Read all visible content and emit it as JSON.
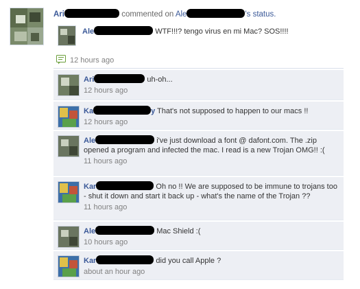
{
  "post": {
    "actor_prefix": "Ari",
    "verb": "commented on",
    "target_prefix": "Ale",
    "target_suffix": "'s status.",
    "status_author_prefix": "Ale",
    "status_text": "WTF!!!? tengo virus en mi Mac? SOS!!!!",
    "time": "12 hours ago",
    "comment_icon": "comment-bubble-icon"
  },
  "comments": [
    {
      "author_prefix": "Ari",
      "text": "uh-oh...",
      "time": "12 hours ago"
    },
    {
      "author_prefix": "Ka",
      "author_tail": "y",
      "text": "That's not supposed to happen to our macs !!",
      "time": "12 hours ago"
    },
    {
      "author_prefix": "Ale",
      "text": "i've just download a font @ dafont.com. The .zip opened a program and infected the mac. I read is a new Trojan OMG!! :(",
      "time": "11 hours ago"
    },
    {
      "author_prefix": "Kar",
      "text": "Oh no !! We are supposed to be immune to trojans too - shut it down and start it back up - what's the name of the Trojan ??",
      "time": "11 hours ago"
    },
    {
      "author_prefix": "Ale",
      "text": "Mac Shield :(",
      "time": "10 hours ago"
    },
    {
      "author_prefix": "Kar",
      "text": "did you call Apple ?",
      "time": "about an hour ago"
    }
  ],
  "colors": {
    "link": "#3b5998",
    "comment_bg": "#edeff4",
    "muted": "#808080",
    "redaction": "#000000"
  }
}
